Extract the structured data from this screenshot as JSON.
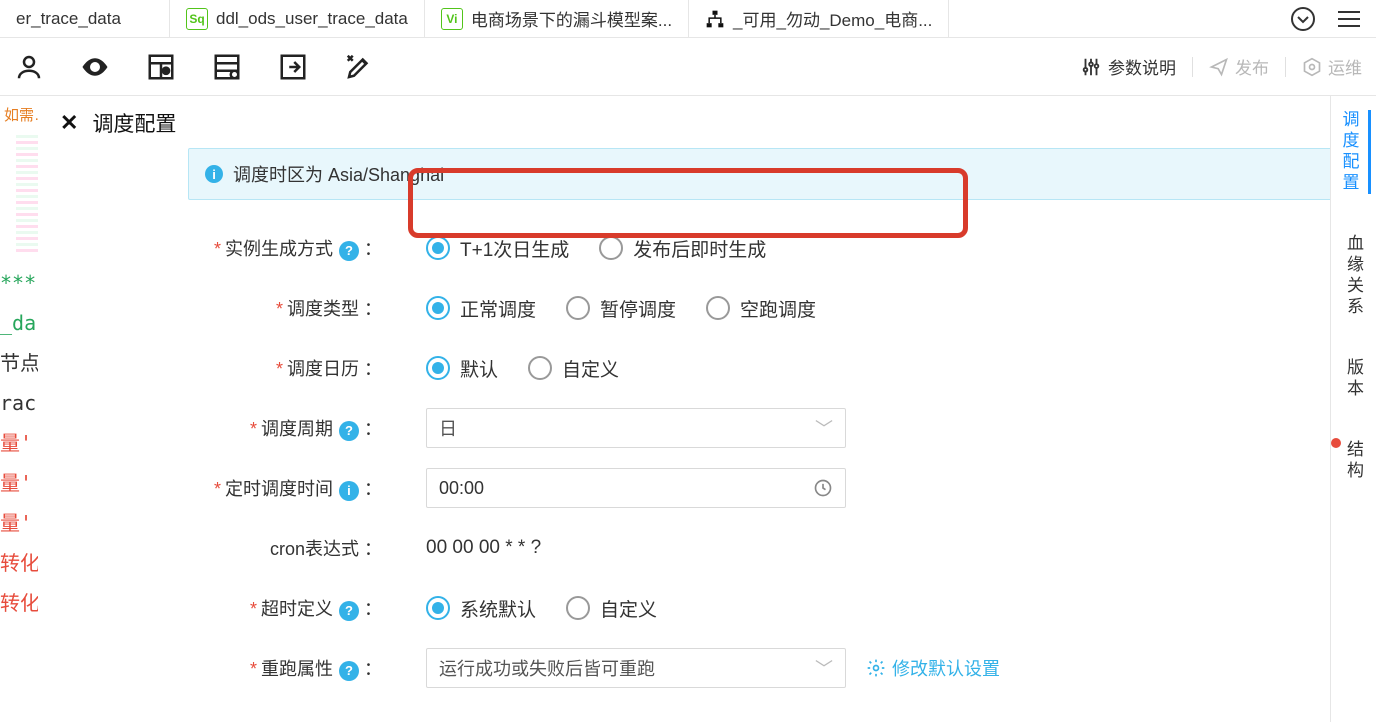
{
  "tabs": [
    {
      "label": "er_trace_data"
    },
    {
      "badge": "Sq",
      "label": "ddl_ods_user_trace_data"
    },
    {
      "badge": "Vi",
      "label": "电商场景下的漏斗模型案..."
    },
    {
      "icon": "workflow",
      "label": "_可用_勿动_Demo_电商..."
    }
  ],
  "toolbar_right": {
    "params": "参数说明",
    "publish": "发布",
    "ops": "运维"
  },
  "leftbar": {
    "warn": "如需…",
    "code": [
      "***",
      "_da",
      "节点",
      "rac",
      " ",
      "量'",
      "量'",
      "量'",
      "转化",
      "转化"
    ]
  },
  "panel": {
    "title": "调度配置",
    "info": "调度时区为 Asia/Shanghai"
  },
  "form": {
    "gen_label": "实例生成方式",
    "gen_opts": [
      "T+1次日生成",
      "发布后即时生成"
    ],
    "sched_type_label": "调度类型",
    "sched_type_opts": [
      "正常调度",
      "暂停调度",
      "空跑调度"
    ],
    "calendar_label": "调度日历",
    "calendar_opts": [
      "默认",
      "自定义"
    ],
    "period_label": "调度周期",
    "period_value": "日",
    "time_label": "定时调度时间",
    "time_value": "00:00",
    "cron_label": "cron表达式",
    "cron_value": "00 00 00 * * ?",
    "timeout_label": "超时定义",
    "timeout_opts": [
      "系统默认",
      "自定义"
    ],
    "rerun_label": "重跑属性",
    "rerun_value": "运行成功或失败后皆可重跑",
    "rerun_action": "修改默认设置"
  },
  "rail": [
    "调度配置",
    "血缘关系",
    "版本",
    "结构"
  ]
}
